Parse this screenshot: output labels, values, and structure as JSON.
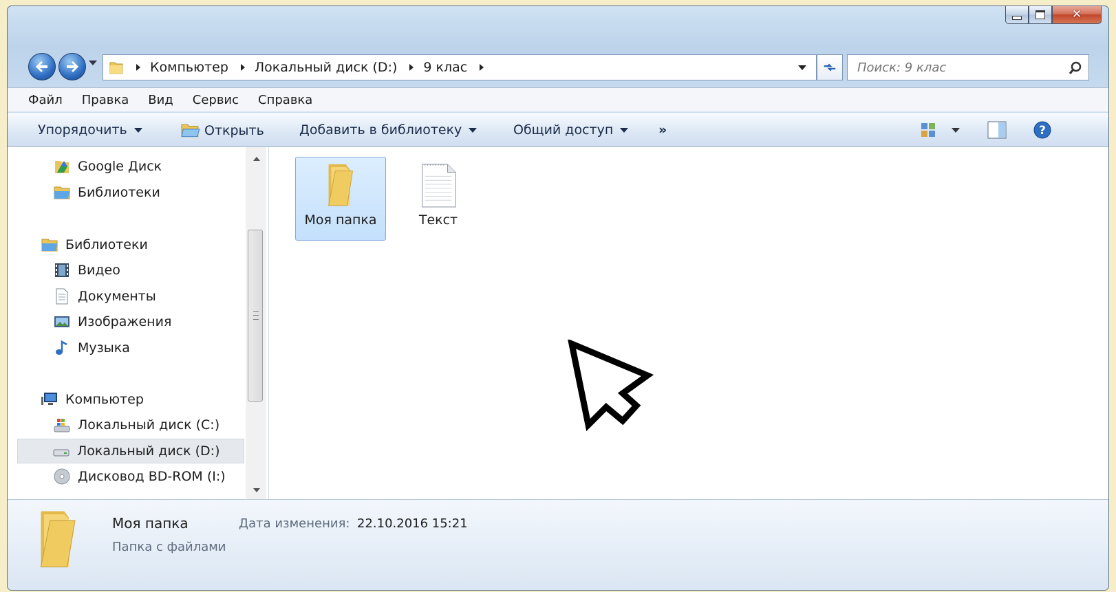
{
  "window": {
    "controls": {
      "minimize_icon": "minimize-icon",
      "maximize_icon": "maximize-icon",
      "close_icon": "close-icon"
    }
  },
  "address": {
    "breadcrumb": [
      "Компьютер",
      "Локальный диск (D:)",
      "9 клас"
    ],
    "search_placeholder": "Поиск: 9 клас"
  },
  "menu": [
    "Файл",
    "Правка",
    "Вид",
    "Сервис",
    "Справка"
  ],
  "toolbar": {
    "organize": "Упорядочить",
    "open": "Открыть",
    "add_to_library": "Добавить в библиотеку",
    "share": "Общий доступ",
    "more": "»"
  },
  "nav_tree": [
    {
      "label": "Google Диск",
      "icon": "google-drive-icon"
    },
    {
      "label": "Библиотеки",
      "icon": "library-icon"
    },
    {
      "label": "Библиотеки",
      "icon": "library-icon"
    },
    {
      "label": "Видео",
      "icon": "video-icon"
    },
    {
      "label": "Документы",
      "icon": "documents-icon"
    },
    {
      "label": "Изображения",
      "icon": "pictures-icon"
    },
    {
      "label": "Музыка",
      "icon": "music-icon"
    },
    {
      "label": "Компьютер",
      "icon": "computer-icon"
    },
    {
      "label": "Локальный диск (C:)",
      "icon": "system-drive-icon"
    },
    {
      "label": "Локальный диск (D:)",
      "icon": "drive-icon",
      "selected": true
    },
    {
      "label": "Дисковод BD-ROM (I:)",
      "icon": "optical-drive-icon"
    }
  ],
  "files": [
    {
      "name": "Моя папка",
      "type": "folder",
      "selected": true
    },
    {
      "name": "Текст",
      "type": "text-file"
    }
  ],
  "details": {
    "name": "Моя папка",
    "type": "Папка с файлами",
    "date_label": "Дата изменения:",
    "date": "22.10.2016 15:21"
  }
}
